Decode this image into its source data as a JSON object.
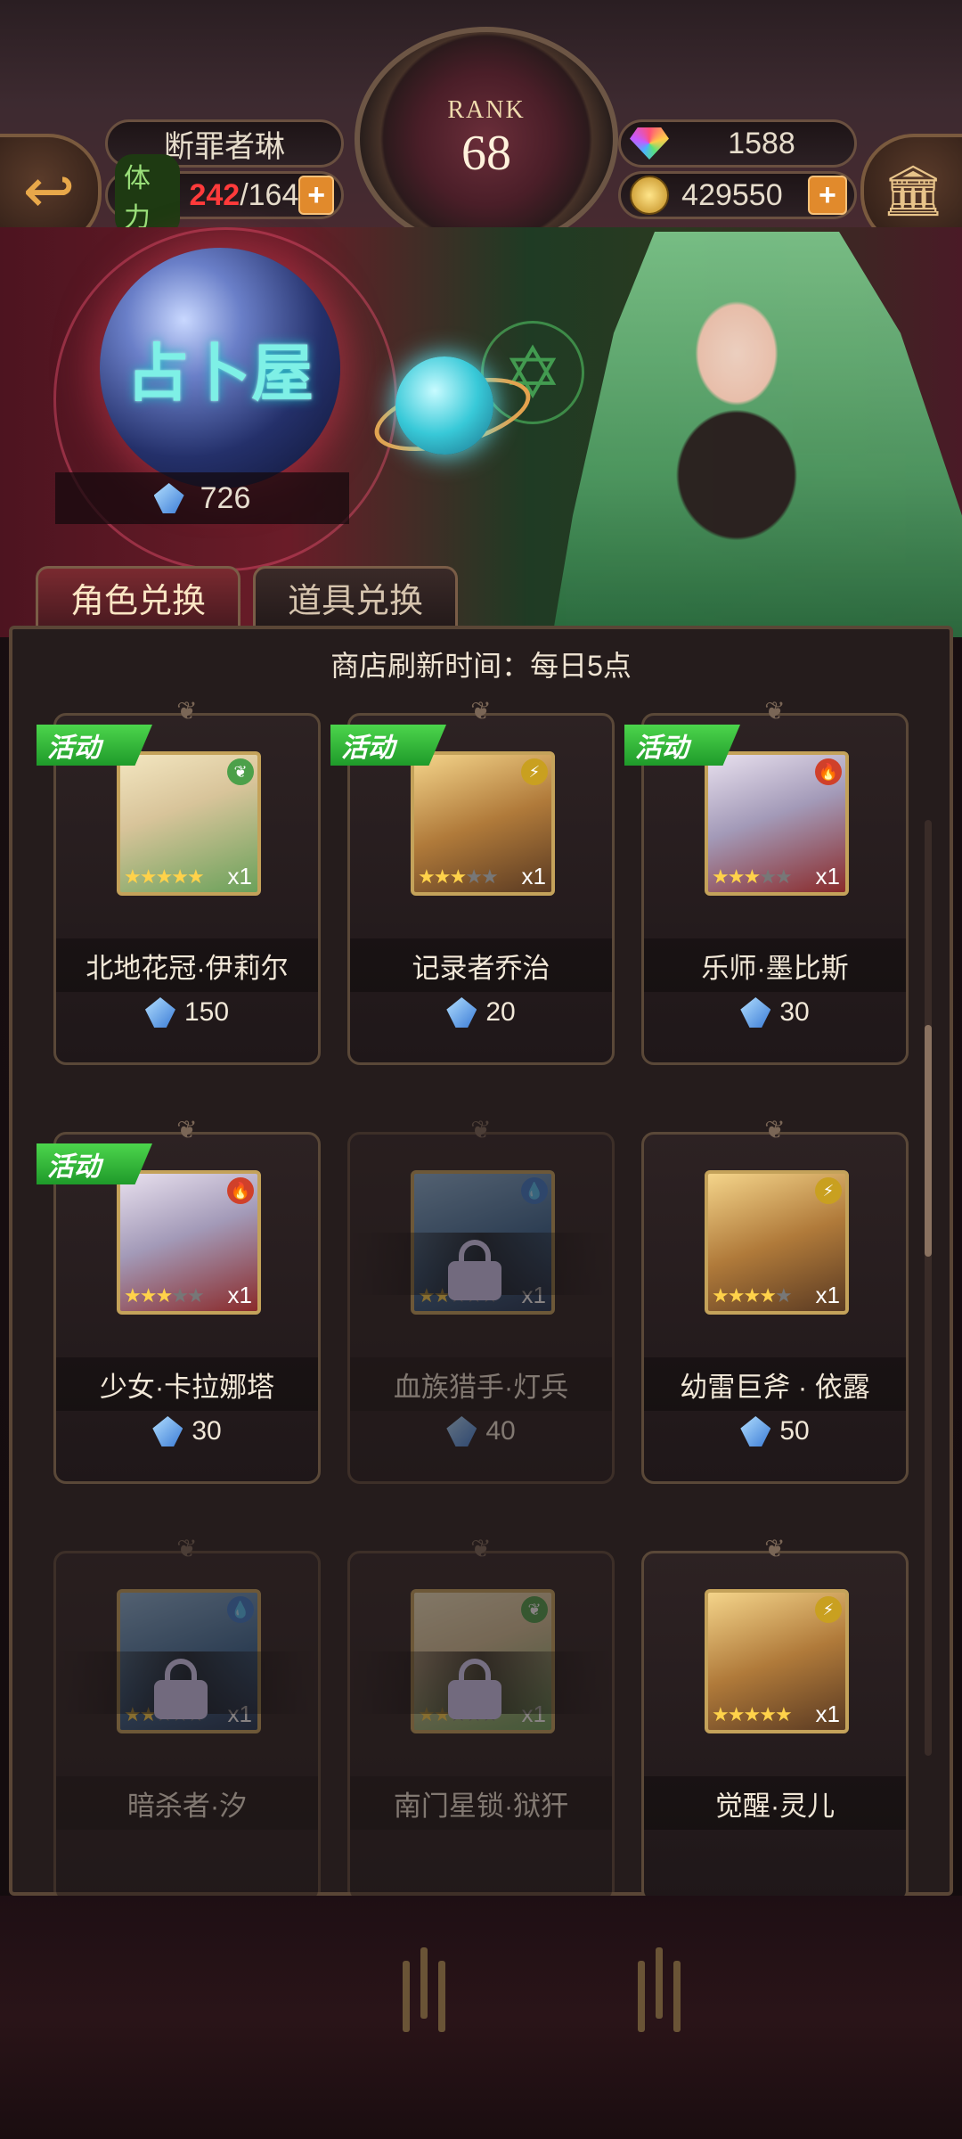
{
  "header": {
    "player_name": "断罪者琳",
    "stamina_label": "体力",
    "stamina_current": "242",
    "stamina_max": "/164",
    "rank_label": "RANK",
    "rank_value": "68",
    "gems": "1588",
    "gold": "429550",
    "plus": "+"
  },
  "banner": {
    "title": "占卜屋",
    "crystal_count": "726"
  },
  "tabs": [
    {
      "label": "角色兑换",
      "active": true
    },
    {
      "label": "道具兑换",
      "active": false
    }
  ],
  "shop": {
    "refresh_text": "商店刷新时间：每日5点",
    "event_tag": "活动",
    "items": [
      {
        "name": "北地花冠·伊莉尔",
        "price": "150",
        "stars": 5,
        "element": "wind",
        "qty": "x1",
        "event": true,
        "locked": false
      },
      {
        "name": "记录者乔治",
        "price": "20",
        "stars": 3,
        "element": "thunder",
        "qty": "x1",
        "event": true,
        "locked": false
      },
      {
        "name": "乐师·墨比斯",
        "price": "30",
        "stars": 3,
        "element": "fire",
        "qty": "x1",
        "event": true,
        "locked": false
      },
      {
        "name": "少女·卡拉娜塔",
        "price": "30",
        "stars": 3,
        "element": "fire",
        "qty": "x1",
        "event": true,
        "locked": false
      },
      {
        "name": "血族猎手·灯兵",
        "price": "40",
        "stars": 2,
        "element": "water",
        "qty": "x1",
        "event": false,
        "locked": true
      },
      {
        "name": "幼雷巨斧 · 依露",
        "price": "50",
        "stars": 4,
        "element": "thunder",
        "qty": "x1",
        "event": false,
        "locked": false
      },
      {
        "name": "暗杀者·汐",
        "price": "",
        "stars": 2,
        "element": "water",
        "qty": "x1",
        "event": false,
        "locked": true
      },
      {
        "name": "南门星锁·狱犴",
        "price": "",
        "stars": 2,
        "element": "wind",
        "qty": "x1",
        "event": false,
        "locked": true
      },
      {
        "name": "觉醒·灵儿",
        "price": "",
        "stars": 5,
        "element": "thunder",
        "qty": "x1",
        "event": false,
        "locked": false
      }
    ]
  },
  "colors": {
    "wind": "#4ca04a",
    "thunder": "#c9a020",
    "fire": "#d0402a",
    "water": "#3a7acc"
  }
}
